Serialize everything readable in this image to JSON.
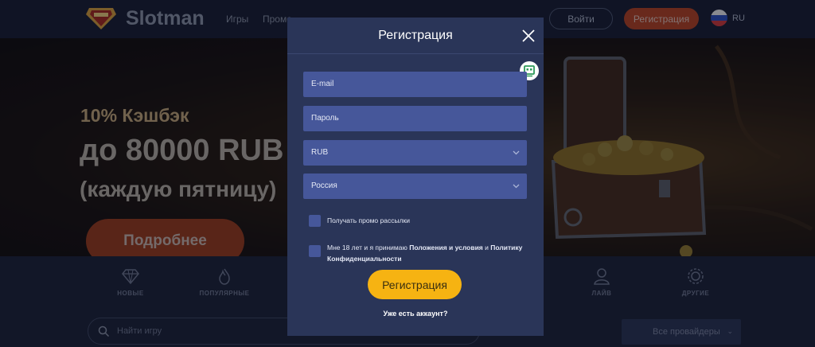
{
  "header": {
    "brand": "Slotman",
    "nav": [
      "Игры",
      "Промо"
    ],
    "login_label": "Войти",
    "register_label": "Регистрация",
    "lang": "RU"
  },
  "banner": {
    "promo_small": "10% Кэшбэк",
    "promo_big": "до 80000 RUB",
    "promo_sub": "(каждую пятницу)",
    "more_label": "Подробнее"
  },
  "categories": [
    {
      "label": "НОВЫЕ",
      "icon": "diamond-icon"
    },
    {
      "label": "ПОПУЛЯРНЫЕ",
      "icon": "flame-icon"
    },
    {
      "label": "ЛАЙВ",
      "icon": "dealer-icon"
    },
    {
      "label": "ДРУГИЕ",
      "icon": "gear-icon"
    }
  ],
  "search": {
    "placeholder": "Найти игру"
  },
  "providers": {
    "label": "Все провайдеры"
  },
  "modal": {
    "title": "Регистрация",
    "email_placeholder": "E-mail",
    "password_placeholder": "Пароль",
    "currency": "RUB",
    "country": "Россия",
    "promo_checkbox": "Получать промо рассылки",
    "terms_prefix": "Мне 18 лет и я принимаю ",
    "terms_link": "Положения и условия",
    "terms_and": " и ",
    "privacy_link": "Политику Конфиденциальности",
    "submit_label": "Регистрация",
    "have_account": "Уже есть аккаунт?"
  },
  "colors": {
    "modal_bg": "#2a3558",
    "field_bg": "#46579a",
    "submit_bg": "#f6b312",
    "header_register_bg": "#b8431f"
  }
}
